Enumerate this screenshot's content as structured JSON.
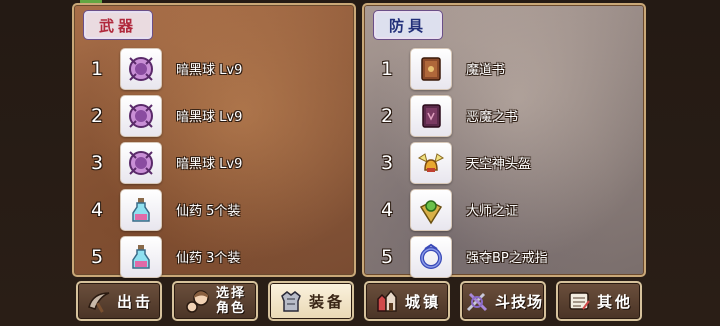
{
  "weapons": {
    "title": "武器",
    "items": [
      {
        "rank": "1",
        "name": "暗黑球 Lv9",
        "icon": "dark-orb-icon"
      },
      {
        "rank": "2",
        "name": "暗黑球 Lv9",
        "icon": "dark-orb-icon"
      },
      {
        "rank": "3",
        "name": "暗黑球 Lv9",
        "icon": "dark-orb-icon"
      },
      {
        "rank": "4",
        "name": "仙药 5个装",
        "icon": "potion-icon"
      },
      {
        "rank": "5",
        "name": "仙药 3个装",
        "icon": "potion-icon"
      }
    ]
  },
  "armor": {
    "title": "防具",
    "items": [
      {
        "rank": "1",
        "name": "魔道书",
        "icon": "grimoire-icon"
      },
      {
        "rank": "2",
        "name": "恶魔之书",
        "icon": "demon-book-icon"
      },
      {
        "rank": "3",
        "name": "天空神头盔",
        "icon": "winged-helmet-icon"
      },
      {
        "rank": "4",
        "name": "大师之证",
        "icon": "master-medal-icon"
      },
      {
        "rank": "5",
        "name": "强夺BP之戒指",
        "icon": "ring-icon"
      }
    ]
  },
  "nav": {
    "sortie": "出击",
    "select_char_line1": "选择",
    "select_char_line2": "角色",
    "equip": "装备",
    "town": "城镇",
    "arena": "斗技场",
    "other": "其他"
  },
  "colors": {
    "weapon_tab_text": "#b0283c",
    "armor_tab_text": "#23307a",
    "active_nav_bg": "#fbf2de"
  }
}
